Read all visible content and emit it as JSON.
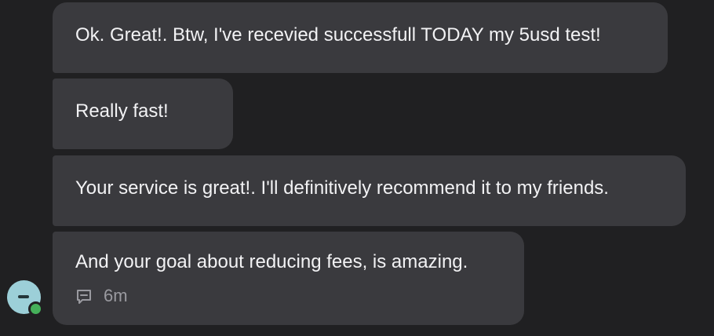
{
  "messages": [
    {
      "text": "Ok. Great!. Btw, I've recevied successfull TODAY my 5usd test!"
    },
    {
      "text": "Really fast!"
    },
    {
      "text": "Your service is great!. I'll definitively recommend it to my friends."
    },
    {
      "text": "And your goal about reducing fees, is amazing.",
      "time": "6m"
    }
  ],
  "avatar": {
    "status": "online",
    "status_color": "#45b05a"
  },
  "colors": {
    "background": "#202022",
    "bubble": "#3a3a3e",
    "text": "#f2f2f4",
    "meta": "#9a9aa0"
  }
}
